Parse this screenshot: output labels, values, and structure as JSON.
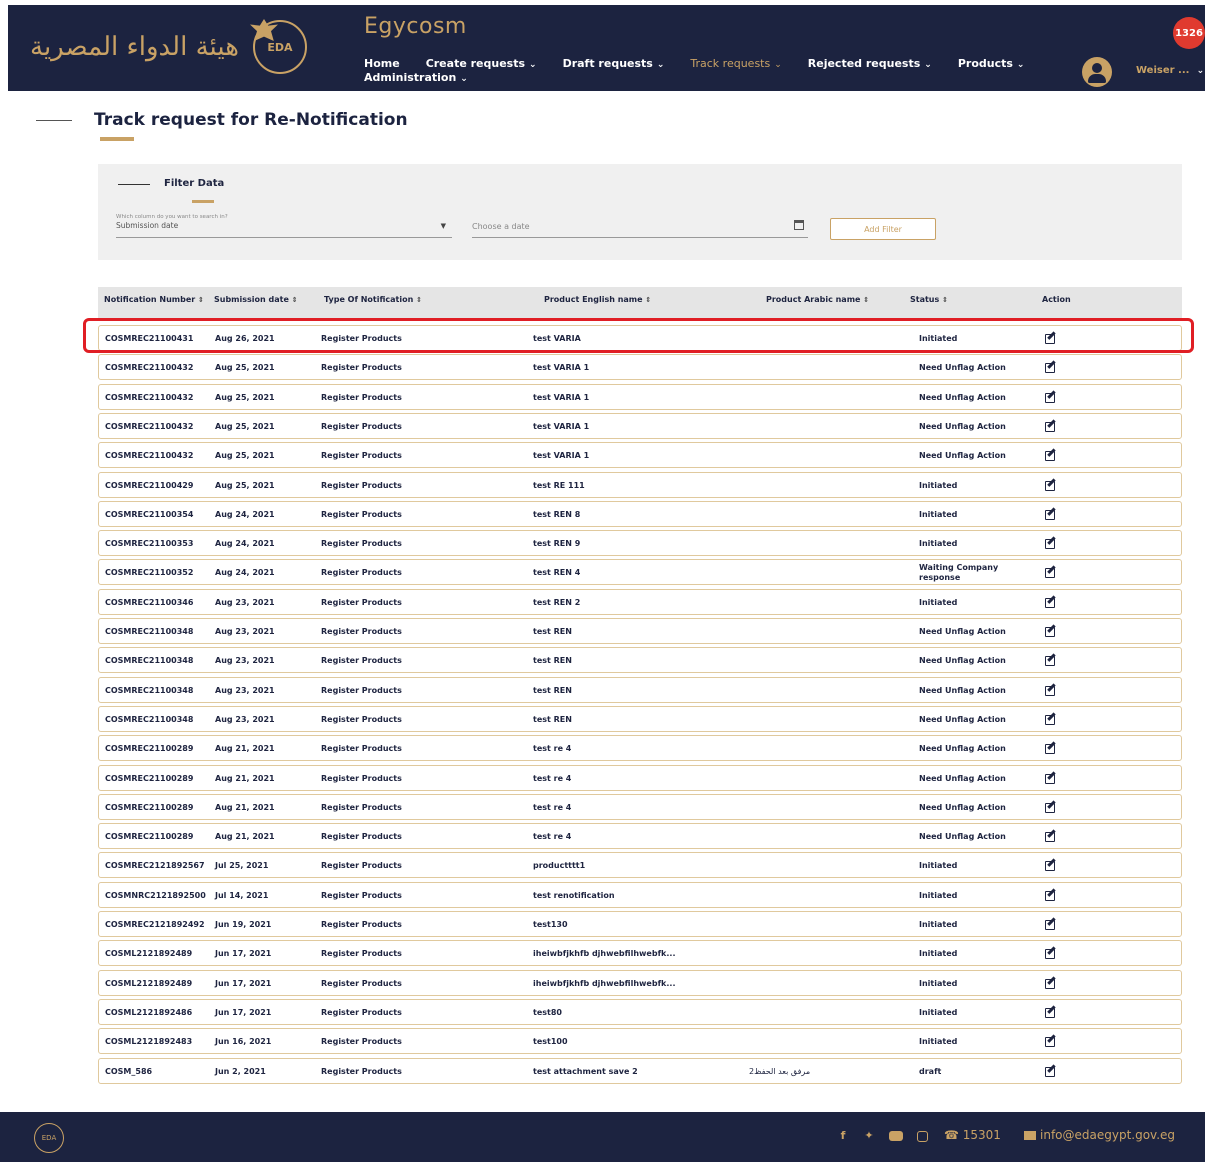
{
  "header": {
    "brand_arabic": "هيئة الدواء المصرية",
    "logo_text": "EDA",
    "app_title": "Egycosm",
    "notifications_count": "1326",
    "nav": [
      {
        "label": "Home",
        "has_caret": false,
        "active": false
      },
      {
        "label": "Create requests",
        "has_caret": true,
        "active": false
      },
      {
        "label": "Draft requests",
        "has_caret": true,
        "active": false
      },
      {
        "label": "Track requests",
        "has_caret": true,
        "active": true
      },
      {
        "label": "Rejected requests",
        "has_caret": true,
        "active": false
      },
      {
        "label": "Products",
        "has_caret": true,
        "active": false
      },
      {
        "label": "Administration",
        "has_caret": true,
        "active": false
      }
    ],
    "user_name": "Weiser ..."
  },
  "page": {
    "title": "Track request for Re-Notification"
  },
  "filter": {
    "title": "Filter Data",
    "search_label": "Which column do you want to search in?",
    "search_value": "Submission date",
    "date_placeholder": "Choose a date",
    "add_filter_label": "Add Filter"
  },
  "table": {
    "columns": [
      {
        "label": "Notification Number",
        "sortable": true
      },
      {
        "label": "Submission date",
        "sortable": true
      },
      {
        "label": "Type Of Notification",
        "sortable": true
      },
      {
        "label": "Product English name",
        "sortable": true
      },
      {
        "label": "Product Arabic name",
        "sortable": true
      },
      {
        "label": "Status",
        "sortable": true
      },
      {
        "label": "Action",
        "sortable": false
      }
    ],
    "sort_glyph": "⇕",
    "rows": [
      [
        "COSMREC21100431",
        "Aug 26, 2021",
        "Register Products",
        "test VARIA",
        "",
        "Initiated"
      ],
      [
        "COSMREC21100432",
        "Aug 25, 2021",
        "Register Products",
        "test VARIA 1",
        "",
        "Need Unflag Action"
      ],
      [
        "COSMREC21100432",
        "Aug 25, 2021",
        "Register Products",
        "test VARIA 1",
        "",
        "Need Unflag Action"
      ],
      [
        "COSMREC21100432",
        "Aug 25, 2021",
        "Register Products",
        "test VARIA 1",
        "",
        "Need Unflag Action"
      ],
      [
        "COSMREC21100432",
        "Aug 25, 2021",
        "Register Products",
        "test VARIA 1",
        "",
        "Need Unflag Action"
      ],
      [
        "COSMREC21100429",
        "Aug 25, 2021",
        "Register Products",
        "test RE 111",
        "",
        "Initiated"
      ],
      [
        "COSMREC21100354",
        "Aug 24, 2021",
        "Register Products",
        "test REN 8",
        "",
        "Initiated"
      ],
      [
        "COSMREC21100353",
        "Aug 24, 2021",
        "Register Products",
        "test REN 9",
        "",
        "Initiated"
      ],
      [
        "COSMREC21100352",
        "Aug 24, 2021",
        "Register Products",
        "test REN 4",
        "",
        "Waiting Company response"
      ],
      [
        "COSMREC21100346",
        "Aug 23, 2021",
        "Register Products",
        "test REN 2",
        "",
        "Initiated"
      ],
      [
        "COSMREC21100348",
        "Aug 23, 2021",
        "Register Products",
        "test REN",
        "",
        "Need Unflag Action"
      ],
      [
        "COSMREC21100348",
        "Aug 23, 2021",
        "Register Products",
        "test REN",
        "",
        "Need Unflag Action"
      ],
      [
        "COSMREC21100348",
        "Aug 23, 2021",
        "Register Products",
        "test REN",
        "",
        "Need Unflag Action"
      ],
      [
        "COSMREC21100348",
        "Aug 23, 2021",
        "Register Products",
        "test REN",
        "",
        "Need Unflag Action"
      ],
      [
        "COSMREC21100289",
        "Aug 21, 2021",
        "Register Products",
        "test re 4",
        "",
        "Need Unflag Action"
      ],
      [
        "COSMREC21100289",
        "Aug 21, 2021",
        "Register Products",
        "test re 4",
        "",
        "Need Unflag Action"
      ],
      [
        "COSMREC21100289",
        "Aug 21, 2021",
        "Register Products",
        "test re 4",
        "",
        "Need Unflag Action"
      ],
      [
        "COSMREC21100289",
        "Aug 21, 2021",
        "Register Products",
        "test re 4",
        "",
        "Need Unflag Action"
      ],
      [
        "COSMREC2121892567",
        "Jul 25, 2021",
        "Register Products",
        "productttt1",
        "",
        "Initiated"
      ],
      [
        "COSMNRC2121892500",
        "Jul 14, 2021",
        "Register Products",
        "test renotification",
        "",
        "Initiated"
      ],
      [
        "COSMREC2121892492",
        "Jun 19, 2021",
        "Register Products",
        "test130",
        "",
        "Initiated"
      ],
      [
        "COSML2121892489",
        "Jun 17, 2021",
        "Register Products",
        "iheiwbfjkhfb djhwebfilhwebfk...",
        "",
        "Initiated"
      ],
      [
        "COSML2121892489",
        "Jun 17, 2021",
        "Register Products",
        "iheiwbfjkhfb djhwebfilhwebfk...",
        "",
        "Initiated"
      ],
      [
        "COSML2121892486",
        "Jun 17, 2021",
        "Register Products",
        "test80",
        "",
        "Initiated"
      ],
      [
        "COSML2121892483",
        "Jun 16, 2021",
        "Register Products",
        "test100",
        "",
        "Initiated"
      ],
      [
        "COSM_586",
        "Jun 2, 2021",
        "Register Products",
        "test attachment save 2",
        "مرفق بعد الحفظ2",
        "draft"
      ]
    ]
  },
  "footer": {
    "phone": "15301",
    "email": "info@edaegypt.gov.eg"
  },
  "colors": {
    "navy": "#1c2340",
    "gold": "#c9a265",
    "highlight": "#e01e24",
    "badge": "#e03a2f"
  }
}
